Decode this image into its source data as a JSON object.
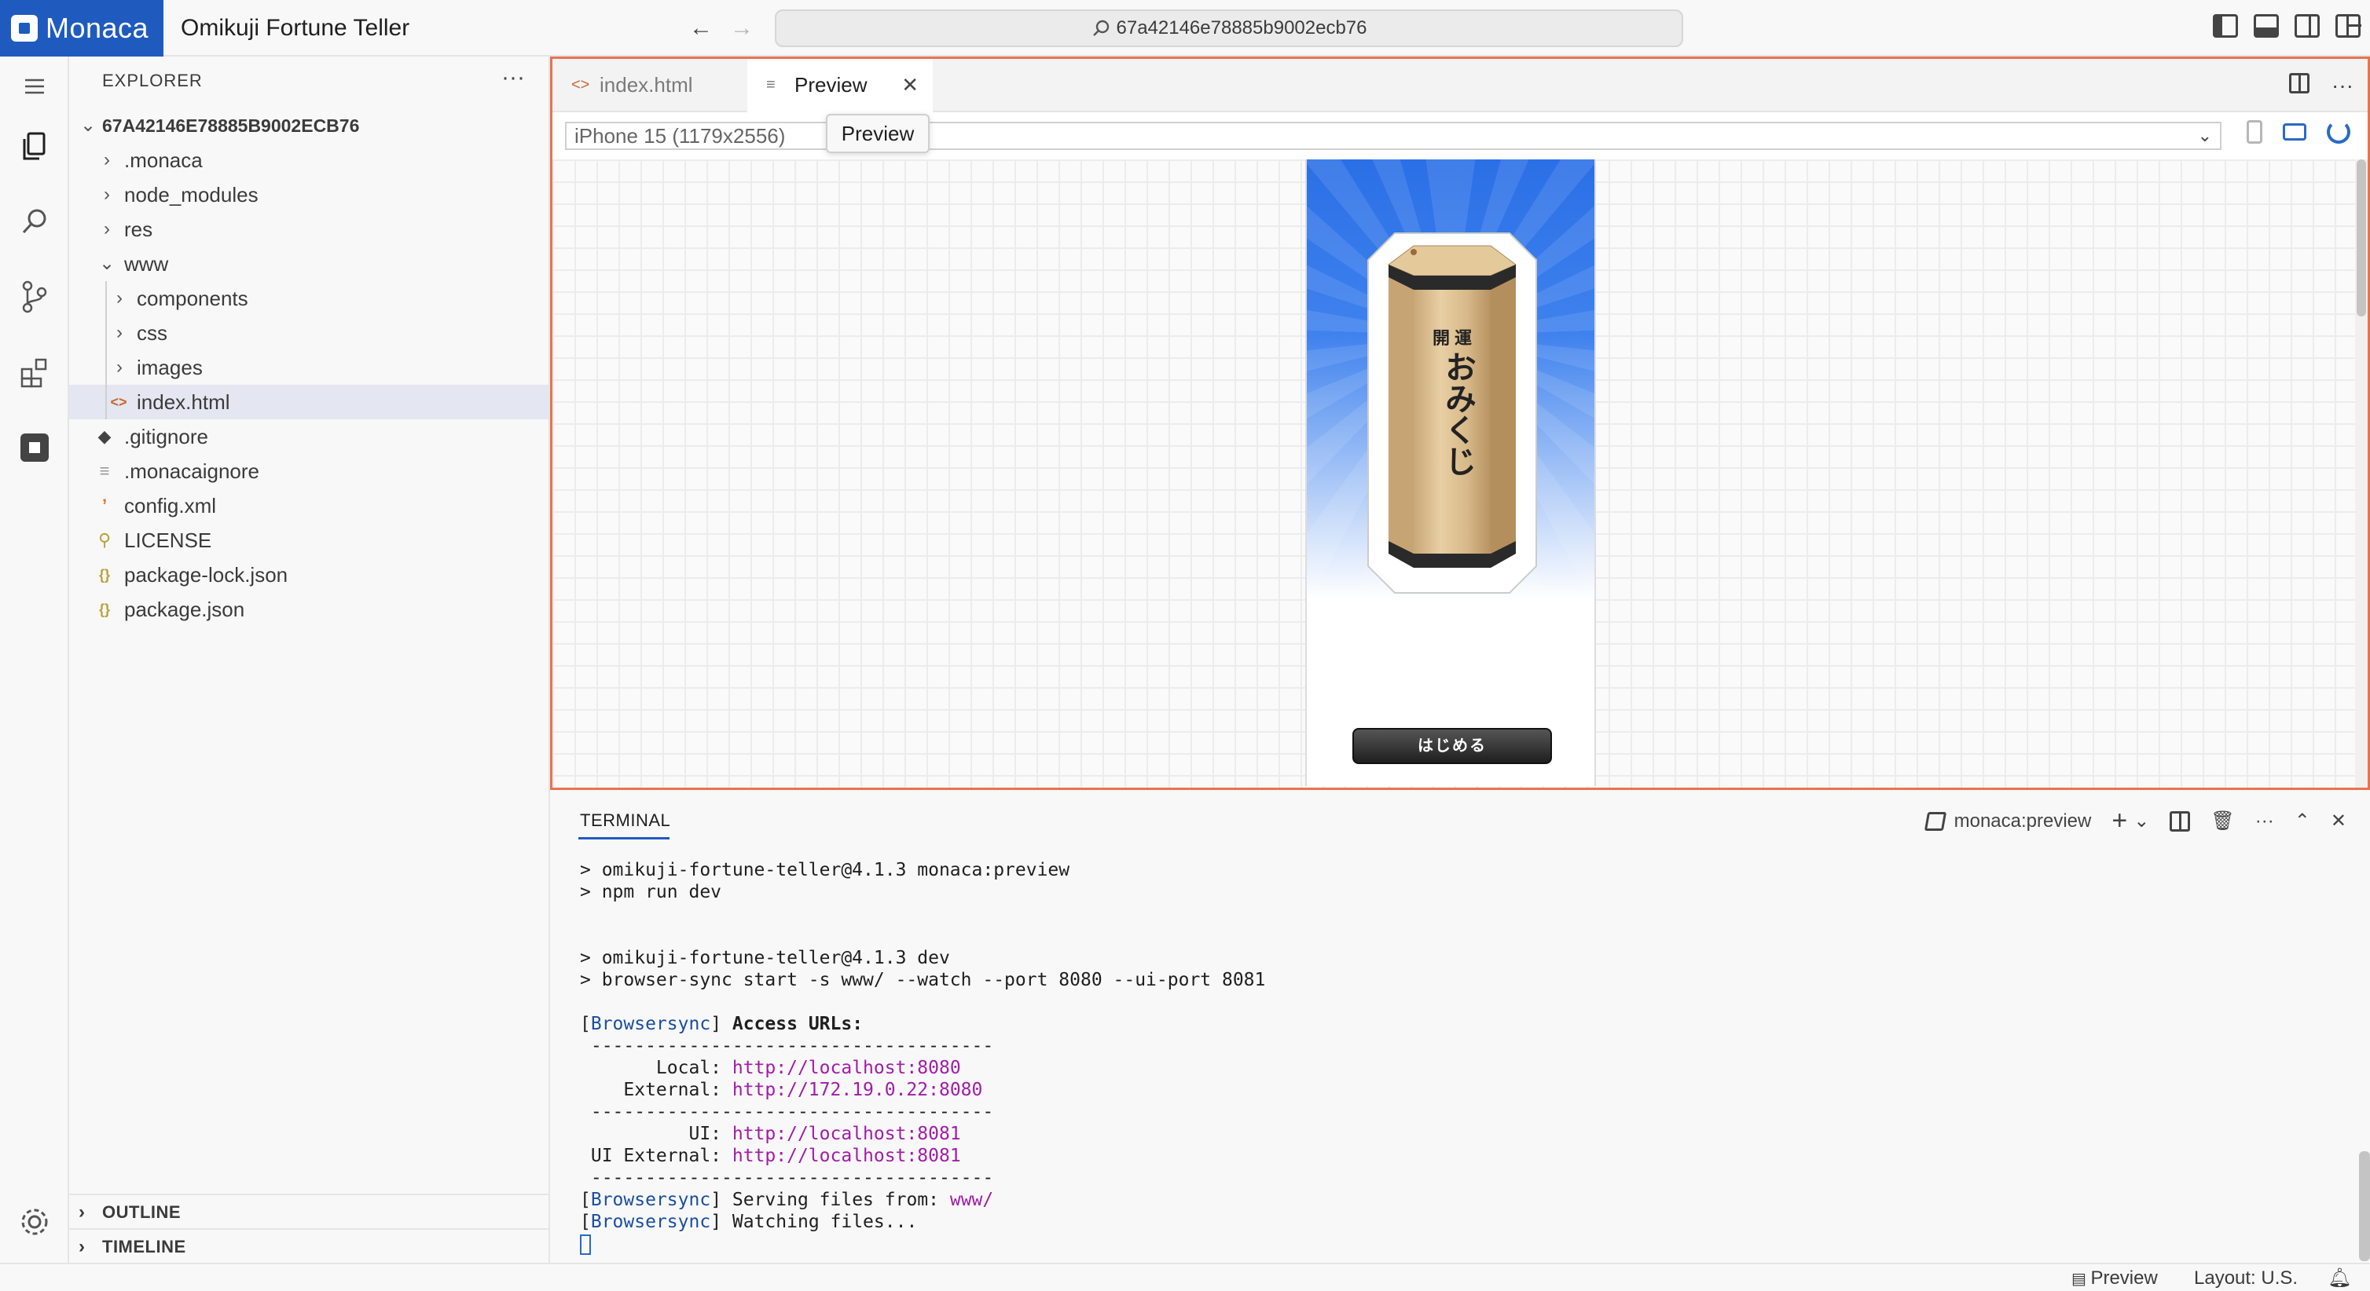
{
  "titlebar": {
    "brand": "Monaca",
    "app_title": "Omikuji Fortune Teller",
    "search_text": "67a42146e78885b9002ecb76"
  },
  "sidebar": {
    "header": "EXPLORER",
    "root": "67A42146E78885B9002ECB76",
    "items": [
      {
        "label": ".monaca",
        "type": "folder",
        "expanded": false
      },
      {
        "label": "node_modules",
        "type": "folder",
        "expanded": false
      },
      {
        "label": "res",
        "type": "folder",
        "expanded": false
      },
      {
        "label": "www",
        "type": "folder",
        "expanded": true
      },
      {
        "label": "components",
        "type": "folder",
        "expanded": false
      },
      {
        "label": "css",
        "type": "folder",
        "expanded": false
      },
      {
        "label": "images",
        "type": "folder",
        "expanded": false
      },
      {
        "label": "index.html",
        "type": "html",
        "selected": true
      },
      {
        "label": ".gitignore",
        "type": "git"
      },
      {
        "label": ".monacaignore",
        "type": "text"
      },
      {
        "label": "config.xml",
        "type": "xml"
      },
      {
        "label": "LICENSE",
        "type": "license"
      },
      {
        "label": "package-lock.json",
        "type": "json"
      },
      {
        "label": "package.json",
        "type": "json"
      }
    ],
    "sections": [
      "OUTLINE",
      "TIMELINE"
    ]
  },
  "editor": {
    "tabs": [
      {
        "label": "index.html",
        "active": false
      },
      {
        "label": "Preview",
        "active": true
      }
    ],
    "tooltip": "Preview",
    "device": "iPhone 15 (1179x2556)",
    "app": {
      "box_top_text": "開運",
      "box_main_text": "おみくじ",
      "start_button": "はじめる"
    }
  },
  "panel": {
    "tab": "TERMINAL",
    "terminal_name": "monaca:preview",
    "lines": {
      "l1": "> omikuji-fortune-teller@4.1.3 monaca:preview",
      "l2": "> npm run dev",
      "l3": "> omikuji-fortune-teller@4.1.3 dev",
      "l4": "> browser-sync start -s www/ --watch --port 8080 --ui-port 8081",
      "bs": "Browsersync",
      "access": "Access URLs:",
      "divider": " -------------------------------------",
      "local_label": "       Local: ",
      "local_url": "http://localhost:8080",
      "external_label": "    External: ",
      "external_url": "http://172.19.0.22:8080",
      "ui_label": "          UI: ",
      "ui_url": "http://localhost:8081",
      "ui_ext_label": " UI External: ",
      "ui_ext_url": "http://localhost:8081",
      "serving": " Serving files from: ",
      "serving_path": "www/",
      "watching": " Watching files..."
    }
  },
  "statusbar": {
    "preview": "Preview",
    "layout": "Layout: U.S."
  },
  "colors": {
    "brand": "#1f5bbf",
    "focus_border": "#e8744f",
    "link": "#a21ca8"
  }
}
